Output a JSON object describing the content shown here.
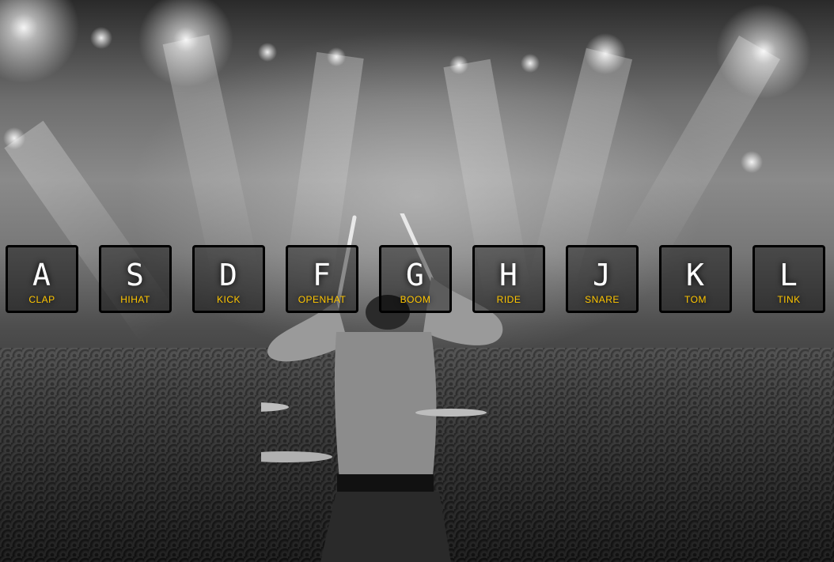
{
  "keys": [
    {
      "letter": "A",
      "sound": "CLAP"
    },
    {
      "letter": "S",
      "sound": "HIHAT"
    },
    {
      "letter": "D",
      "sound": "KICK"
    },
    {
      "letter": "F",
      "sound": "OPENHAT"
    },
    {
      "letter": "G",
      "sound": "BOOM"
    },
    {
      "letter": "H",
      "sound": "RIDE"
    },
    {
      "letter": "J",
      "sound": "SNARE"
    },
    {
      "letter": "K",
      "sound": "TOM"
    },
    {
      "letter": "L",
      "sound": "TINK"
    }
  ],
  "colors": {
    "sound_label": "#ffc600",
    "key_letter": "#ffffff",
    "key_border": "#000000"
  },
  "background": {
    "image": "concert-drummer-photo"
  }
}
